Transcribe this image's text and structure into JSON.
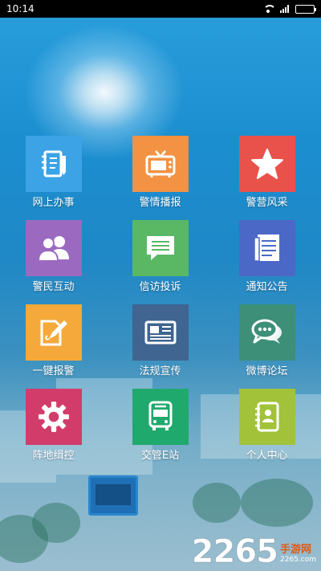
{
  "status_bar": {
    "time": "10:14"
  },
  "tiles": [
    {
      "label": "网上办事",
      "color": "#3ba3e6",
      "icon": "notepad-icon"
    },
    {
      "label": "警情播报",
      "color": "#f39243",
      "icon": "tv-icon"
    },
    {
      "label": "警营风采",
      "color": "#e8524a",
      "icon": "star-icon"
    },
    {
      "label": "警民互动",
      "color": "#9b6ac0",
      "icon": "users-icon"
    },
    {
      "label": "信访投诉",
      "color": "#5ab865",
      "icon": "message-icon"
    },
    {
      "label": "通知公告",
      "color": "#4c68c6",
      "icon": "document-icon"
    },
    {
      "label": "一键报警",
      "color": "#f5a93a",
      "icon": "edit-icon"
    },
    {
      "label": "法规宣传",
      "color": "#3f6590",
      "icon": "newspaper-icon"
    },
    {
      "label": "微博论坛",
      "color": "#3d8f78",
      "icon": "chat-icon"
    },
    {
      "label": "阵地缉控",
      "color": "#d23c6b",
      "icon": "gear-icon"
    },
    {
      "label": "交管E站",
      "color": "#20a96d",
      "icon": "bus-icon"
    },
    {
      "label": "个人中心",
      "color": "#a2c23a",
      "icon": "contacts-icon"
    }
  ],
  "watermark": {
    "number": "2265",
    "text": "手游网",
    "domain": "2265.com"
  }
}
